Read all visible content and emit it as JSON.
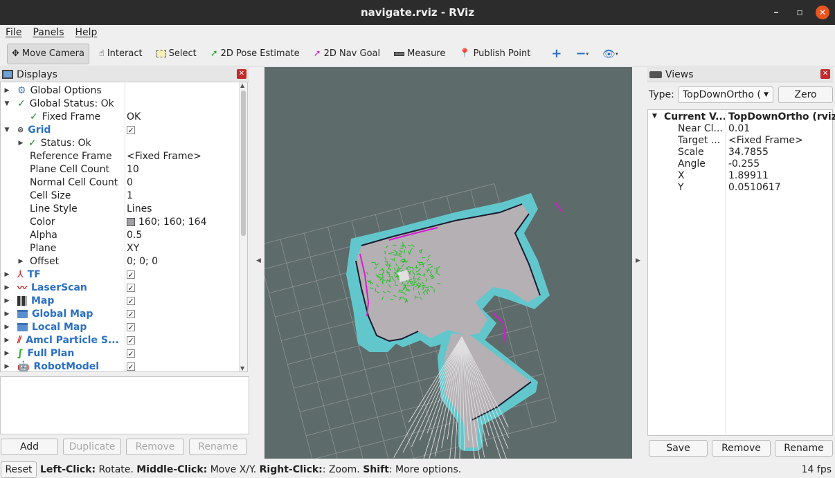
{
  "window": {
    "title": "navigate.rviz - RViz",
    "minimize": "–",
    "maximize": "▫",
    "close": "✕"
  },
  "menu": {
    "file": "File",
    "panels": "Panels",
    "help": "Help"
  },
  "toolbar": {
    "move_camera": "Move Camera",
    "interact": "Interact",
    "select": "Select",
    "pose_estimate": "2D Pose Estimate",
    "nav_goal": "2D Nav Goal",
    "measure": "Measure",
    "publish_point": "Publish Point"
  },
  "displays": {
    "title": "Displays",
    "rows": [
      {
        "label": "Global Options",
        "value": ""
      },
      {
        "label": "Global Status: Ok",
        "value": ""
      },
      {
        "label": "Fixed Frame",
        "value": "OK"
      },
      {
        "label": "Grid",
        "value": ""
      },
      {
        "label": "Status: Ok",
        "value": ""
      },
      {
        "label": "Reference Frame",
        "value": "<Fixed Frame>"
      },
      {
        "label": "Plane Cell Count",
        "value": "10"
      },
      {
        "label": "Normal Cell Count",
        "value": "0"
      },
      {
        "label": "Cell Size",
        "value": "1"
      },
      {
        "label": "Line Style",
        "value": "Lines"
      },
      {
        "label": "Color",
        "value": "160; 160; 164"
      },
      {
        "label": "Alpha",
        "value": "0.5"
      },
      {
        "label": "Plane",
        "value": "XY"
      },
      {
        "label": "Offset",
        "value": "0; 0; 0"
      },
      {
        "label": "TF",
        "value": ""
      },
      {
        "label": "LaserScan",
        "value": ""
      },
      {
        "label": "Map",
        "value": ""
      },
      {
        "label": "Global Map",
        "value": ""
      },
      {
        "label": "Local Map",
        "value": ""
      },
      {
        "label": "Amcl Particle S...",
        "value": ""
      },
      {
        "label": "Full Plan",
        "value": ""
      },
      {
        "label": "RobotModel",
        "value": ""
      }
    ],
    "buttons": {
      "add": "Add",
      "duplicate": "Duplicate",
      "remove": "Remove",
      "rename": "Rename"
    }
  },
  "views": {
    "title": "Views",
    "type_label": "Type:",
    "type_value": "TopDownOrtho (",
    "zero": "Zero",
    "current_label": "Current V...",
    "current_value": "TopDownOrtho (rviz)",
    "props": [
      {
        "key": "Near Cl...",
        "value": "0.01"
      },
      {
        "key": "Target ...",
        "value": "<Fixed Frame>"
      },
      {
        "key": "Scale",
        "value": "34.7855"
      },
      {
        "key": "Angle",
        "value": "-0.255"
      },
      {
        "key": "X",
        "value": "1.89911"
      },
      {
        "key": "Y",
        "value": "0.0510617"
      }
    ],
    "buttons": {
      "save": "Save",
      "remove": "Remove",
      "rename": "Rename"
    }
  },
  "status": {
    "reset": "Reset",
    "b1": "Left-Click:",
    "t1": " Rotate. ",
    "b2": "Middle-Click:",
    "t2": " Move X/Y. ",
    "b3": "Right-Click:",
    "t3": ": Zoom. ",
    "b4": "Shift",
    "t4": ": More options.",
    "fps": "14 fps"
  },
  "colors": {
    "grid": "#a0a0a4",
    "viewport_bg": "#5d6b6a",
    "map_free": "#b4b0b4",
    "costmap": "#62c7cc",
    "particles": "#21c221",
    "plan": "#d51bd3"
  }
}
